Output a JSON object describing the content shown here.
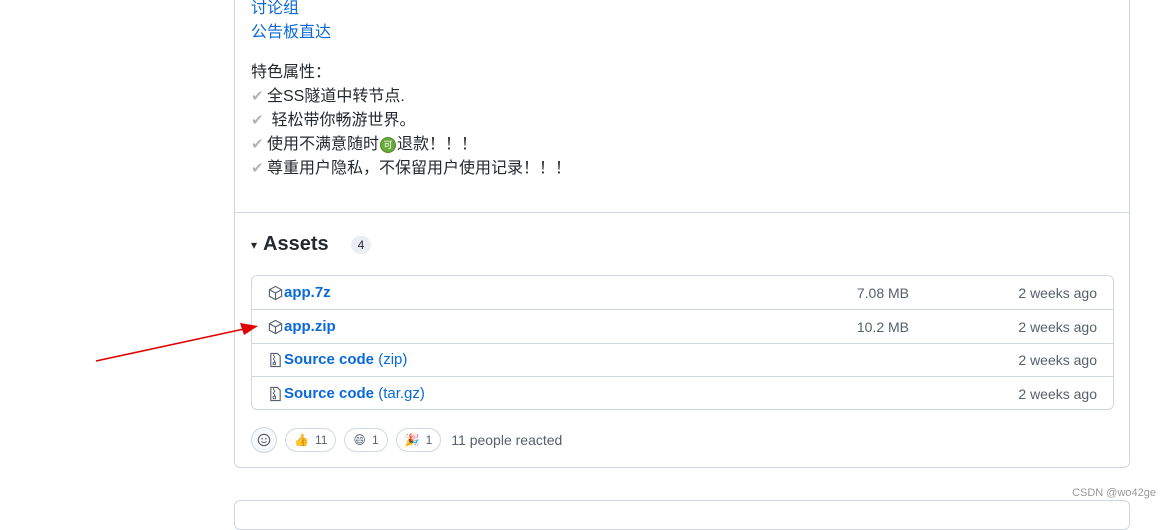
{
  "links": [
    "讨论组",
    "公告板直达"
  ],
  "features": {
    "title": "特色属性：",
    "check_glyph": "✔",
    "items": [
      {
        "before": "全SS隧道中转节点.",
        "icon": "",
        "after": ""
      },
      {
        "before": " 轻松带你畅游世界。",
        "icon": "",
        "after": ""
      },
      {
        "before": "使用不满意随时",
        "icon": "可",
        "after": "退款！！！"
      },
      {
        "before": "尊重用户隐私，不保留用户使用记录！！！",
        "icon": "",
        "after": ""
      }
    ]
  },
  "assets": {
    "caret": "▾",
    "title": "Assets",
    "count": "4",
    "rows": [
      {
        "icon": "package-icon",
        "name": "app.7z",
        "sub": "",
        "size": "7.08 MB",
        "date": "2 weeks ago"
      },
      {
        "icon": "package-icon",
        "name": "app.zip",
        "sub": "",
        "size": "10.2 MB",
        "date": "2 weeks ago"
      },
      {
        "icon": "file-zip-icon",
        "name": "Source code",
        "sub": " (zip)",
        "size": "",
        "date": "2 weeks ago"
      },
      {
        "icon": "file-zip-icon",
        "name": "Source code",
        "sub": " (tar.gz)",
        "size": "",
        "date": "2 weeks ago"
      }
    ]
  },
  "reactions": {
    "items": [
      {
        "emoji": "👍",
        "count": "11",
        "icon": "thumbs-up-icon"
      },
      {
        "emoji": "😄",
        "count": "1",
        "icon": "laugh-icon"
      },
      {
        "emoji": "🎉",
        "count": "1",
        "icon": "hooray-icon"
      }
    ],
    "summary": "11 people reacted"
  },
  "watermark": "CSDN @wo42ge",
  "colors": {
    "link": "#0969da",
    "annotation_arrow": "#e00000"
  }
}
